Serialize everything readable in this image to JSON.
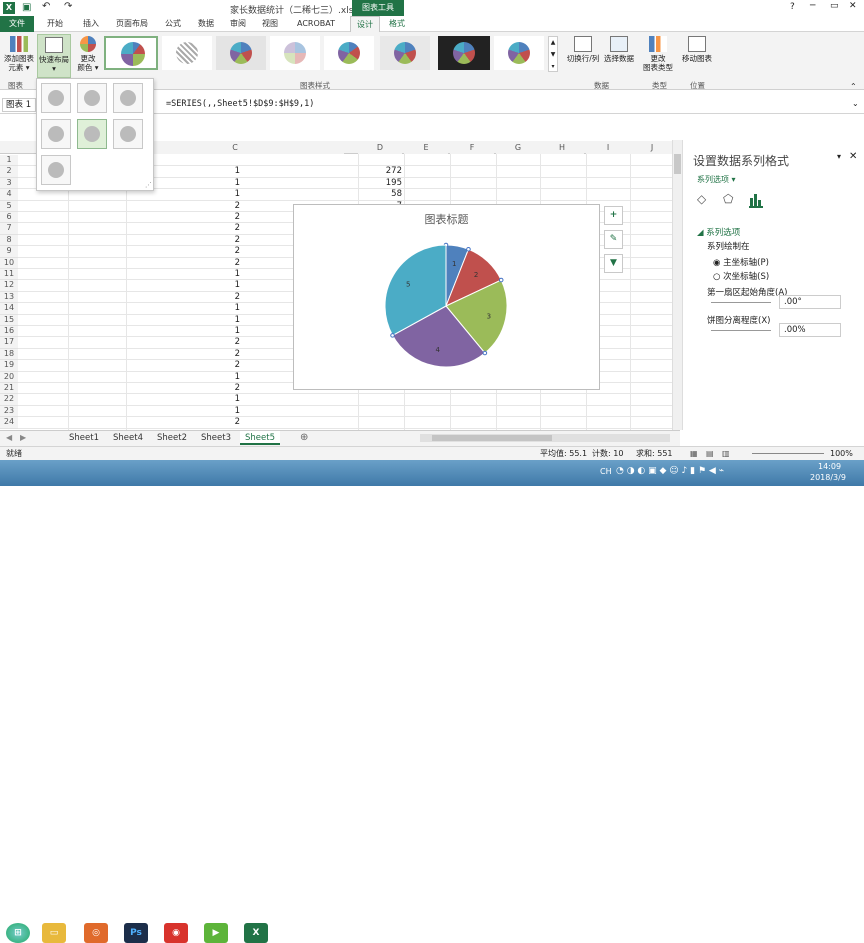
{
  "window": {
    "title": "家长数据统计（二稀七三）.xlsx - Excel",
    "chart_tools": "图表工具",
    "help": "?",
    "minimize": "─",
    "restore": "▭",
    "close": "✕"
  },
  "tabs": [
    "文件",
    "开始",
    "插入",
    "页面布局",
    "公式",
    "数据",
    "审阅",
    "视图",
    "ACROBAT",
    "设计",
    "格式"
  ],
  "ribbon": {
    "add_element": "添加图表\n元素 ▾",
    "quick_layout": "快速布局\n▾",
    "change_colors": "更改\n颜色 ▾",
    "switch_row_col": "切换行/列",
    "select_data": "选择数据",
    "change_type": "更改\n图表类型",
    "move_chart": "移动图表",
    "group_chart_layouts": "图表",
    "group_styles": "图表样式",
    "group_data": "数据",
    "group_type": "类型",
    "group_location": "位置"
  },
  "formula_bar": {
    "name_box": "图表 1",
    "formula": "=SERIES(,,Sheet5!$D$9:$H$9,1)"
  },
  "columns": [
    "C",
    "D",
    "E",
    "F",
    "G",
    "H",
    "I",
    "J"
  ],
  "rows": [
    "1",
    "2",
    "3",
    "4",
    "5",
    "6",
    "7",
    "8",
    "9",
    "10",
    "11",
    "12",
    "13",
    "14",
    "15",
    "16",
    "17",
    "18",
    "19",
    "20",
    "21",
    "22",
    "23",
    "24"
  ],
  "col_c_values": [
    "",
    "1",
    "1",
    "1",
    "2",
    "2",
    "2",
    "2",
    "2",
    "2",
    "1",
    "1",
    "2",
    "1",
    "1",
    "1",
    "2",
    "2",
    "2",
    "1",
    "2",
    "1",
    "1",
    "2"
  ],
  "col_d_values": [
    "",
    "272",
    "195",
    "58",
    "7",
    "",
    "",
    "",
    "",
    "",
    "",
    "",
    "",
    "",
    "",
    "",
    "",
    "",
    "",
    "",
    "",
    "",
    "",
    ""
  ],
  "chart_data": {
    "type": "pie",
    "title": "图表标题",
    "categories": [
      "1",
      "2",
      "3",
      "4",
      "5"
    ],
    "values": [
      6,
      12,
      21,
      28,
      33
    ],
    "colors": [
      "#4f81bd",
      "#c0504d",
      "#9bbb59",
      "#8064a2",
      "#4bacc6"
    ]
  },
  "chart_icons": [
    "plus-icon",
    "brush-icon",
    "filter-icon"
  ],
  "pane": {
    "title": "设置数据系列格式",
    "series_options_dd": "系列选项 ▾",
    "section": "系列选项",
    "plot_on": "系列绘制在",
    "primary_axis": "主坐标轴(P)",
    "secondary_axis": "次坐标轴(S)",
    "first_slice_angle_label": "第一扇区起始角度(A)",
    "first_slice_angle": ".00°",
    "explosion_label": "饼图分离程度(X)",
    "explosion": ".00%"
  },
  "sheets": [
    "Sheet1",
    "Sheet4",
    "Sheet2",
    "Sheet3",
    "Sheet5"
  ],
  "status": {
    "ready": "就绪",
    "average": "平均值: 55.1",
    "count": "计数: 10",
    "sum": "求和: 551",
    "zoom": "100%"
  },
  "clock": {
    "time": "14:09",
    "date": "2018/3/9"
  },
  "tray": {
    "lang": "CH"
  }
}
